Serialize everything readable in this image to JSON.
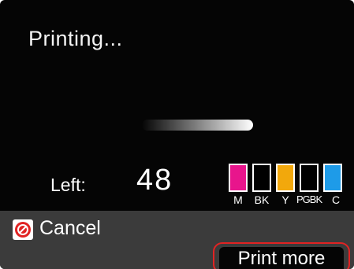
{
  "screen": {
    "status_text": "Printing...",
    "progress_fraction": 0.95
  },
  "remaining": {
    "label": "Left:",
    "value": "48"
  },
  "ink_tanks": [
    {
      "label": "M",
      "color": "#e8158c",
      "level": 1.0
    },
    {
      "label": "BK",
      "color": "#000000",
      "level": 0
    },
    {
      "label": "Y",
      "color": "#f2a80c",
      "level": 1.0
    },
    {
      "label": "PGBK",
      "color": "#000000",
      "level": 0
    },
    {
      "label": "C",
      "color": "#1e9be8",
      "level": 1.0
    }
  ],
  "footer": {
    "cancel_label": "Cancel",
    "print_more_label": "Print more",
    "highlight_color": "#e12323"
  }
}
